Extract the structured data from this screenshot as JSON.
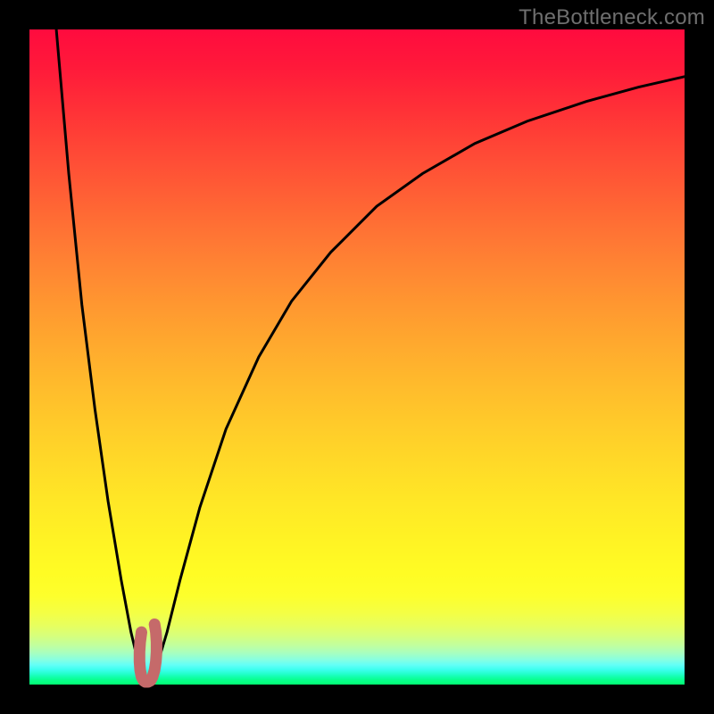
{
  "watermark": "TheBottleneck.com",
  "colors": {
    "frame": "#000000",
    "curve": "#000000",
    "marker": "#c56a6a"
  },
  "chart_data": {
    "type": "line",
    "title": "",
    "xlabel": "",
    "ylabel": "",
    "xlim": [
      0,
      100
    ],
    "ylim": [
      0,
      100
    ],
    "grid": false,
    "legend": false,
    "annotations": [],
    "series": [
      {
        "name": "left-branch",
        "x": [
          4.1,
          6.0,
          8.0,
          10.0,
          12.0,
          14.0,
          15.5,
          16.7,
          17.5
        ],
        "y": [
          100.0,
          78.0,
          58.0,
          42.0,
          28.0,
          16.0,
          8.0,
          3.0,
          0.5
        ]
      },
      {
        "name": "right-branch",
        "x": [
          18.5,
          19.5,
          21.0,
          23.0,
          26.0,
          30.0,
          35.0,
          40.0,
          46.0,
          53.0,
          60.0,
          68.0,
          76.0,
          85.0,
          93.0,
          100.0
        ],
        "y": [
          0.5,
          3.0,
          8.0,
          16.0,
          27.0,
          39.0,
          50.0,
          58.5,
          66.0,
          73.0,
          78.0,
          82.6,
          86.0,
          89.0,
          91.2,
          92.8
        ]
      },
      {
        "name": "vertex-marker",
        "x": [
          17.1,
          16.9,
          16.8,
          16.8,
          16.9,
          17.1,
          17.4,
          17.7,
          18.1,
          18.5,
          18.8,
          19.1,
          19.3,
          19.4,
          19.4,
          19.3,
          19.1
        ],
        "y": [
          8.0,
          6.5,
          5.0,
          3.5,
          2.2,
          1.2,
          0.6,
          0.4,
          0.4,
          0.6,
          1.2,
          2.2,
          3.5,
          5.0,
          6.5,
          8.0,
          9.2
        ]
      }
    ]
  }
}
